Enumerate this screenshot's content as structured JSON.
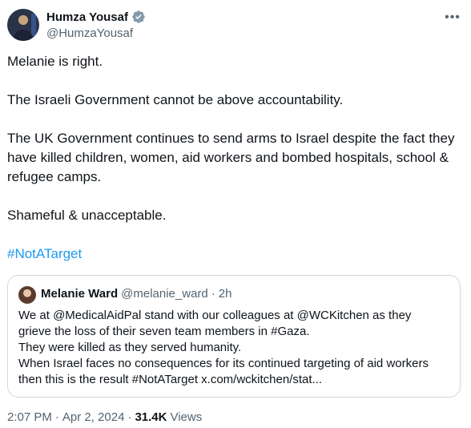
{
  "author": {
    "name": "Humza Yousaf",
    "handle": "@HumzaYousaf"
  },
  "tweet": {
    "paragraphs": [
      "Melanie is right.",
      "The Israeli Government cannot be above accountability.",
      "The UK Government continues to send arms to Israel despite the fact they have killed children, women, aid workers and bombed hospitals, school & refugee camps.",
      "Shameful & unacceptable."
    ],
    "hashtag": "#NotATarget"
  },
  "quote": {
    "name": "Melanie Ward",
    "handle": "@melanie_ward",
    "separator": "·",
    "time": "2h",
    "lines": [
      "We at @MedicalAidPal stand with our colleagues at @WCKitchen as they",
      "grieve the loss of their seven team members in #Gaza.",
      "They were killed as they served humanity.",
      "When Israel faces no consequences for its continued targeting of aid workers",
      "then this is the result #NotATarget x.com/wckitchen/stat..."
    ]
  },
  "meta": {
    "time": "2:07 PM",
    "date": "Apr 2, 2024",
    "separator": "·",
    "views_count": "31.4K",
    "views_label": "Views"
  },
  "colors": {
    "link": "#1d9bf0",
    "secondary_text": "#536471",
    "border": "#cfd9de"
  },
  "icons": {
    "verified": "verified-badge-icon",
    "more": "more-options-icon"
  }
}
